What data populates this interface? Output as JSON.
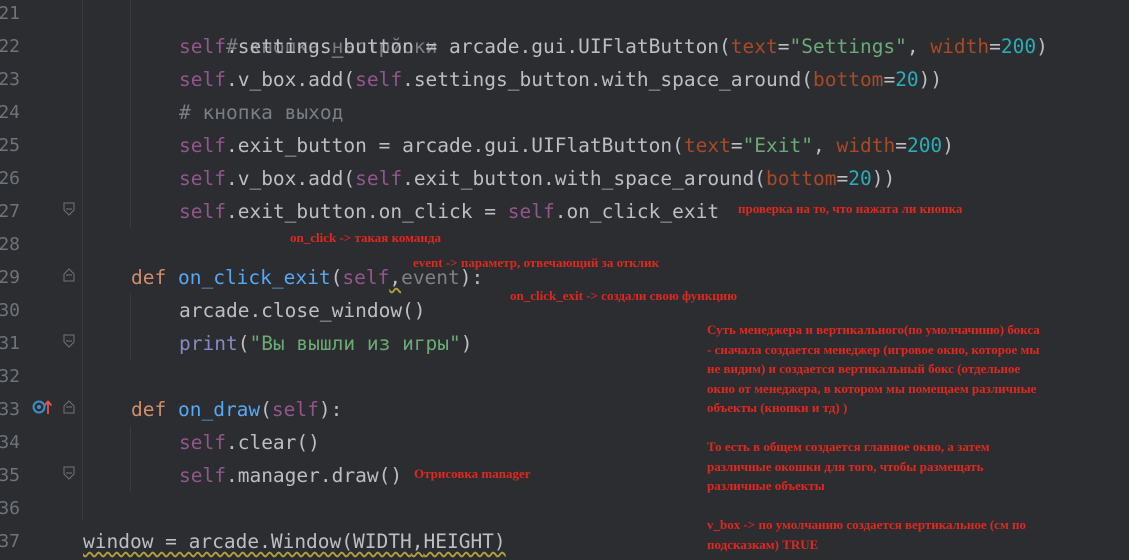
{
  "editor": {
    "line_numbers": [
      "21",
      "22",
      "23",
      "24",
      "25",
      "26",
      "27",
      "28",
      "29",
      "30",
      "31",
      "32",
      "33",
      "34",
      "35",
      "36",
      "37"
    ],
    "lines": {
      "l21": {
        "indent": "        ",
        "comment": "# кнопка настрйоки"
      },
      "l22": {
        "self": "self",
        "p1": ".settings_button = arcade.gui.UIFlatButton(",
        "kw1": "text",
        "eq1": "=",
        "str1": "\"Settings\"",
        "p2": ", ",
        "kw2": "width",
        "eq2": "=",
        "num1": "200",
        "p3": ")"
      },
      "l23": {
        "self": "self",
        "p1": ".v_box.add(",
        "self2": "self",
        "p2": ".settings_button.with_space_around(",
        "kw1": "bottom",
        "eq1": "=",
        "num1": "20",
        "p3": "))"
      },
      "l24": {
        "comment": "# кнопка выход"
      },
      "l25": {
        "self": "self",
        "p1": ".exit_button = arcade.gui.UIFlatButton(",
        "kw1": "text",
        "eq1": "=",
        "str1": "\"Exit\"",
        "p2": ", ",
        "kw2": "width",
        "eq2": "=",
        "num1": "200",
        "p3": ")"
      },
      "l26": {
        "self": "self",
        "p1": ".v_box.add(",
        "self2": "self",
        "p2": ".exit_button.with_space_around(",
        "kw1": "bottom",
        "eq1": "=",
        "num1": "20",
        "p3": "))"
      },
      "l27": {
        "self": "self",
        "p1": ".exit_button.on_click = ",
        "self2": "self",
        "p2": ".on_click_exit"
      },
      "l29": {
        "def": "def",
        "fn": "on_click_exit",
        "p1": "(",
        "self": "self",
        "comma": ",",
        "arg": "event",
        "p2": "):"
      },
      "l30": {
        "text": "arcade.close_window()"
      },
      "l31": {
        "builtin": "print",
        "p1": "(",
        "str": "\"Вы вышли из игры\"",
        "p2": ")"
      },
      "l33": {
        "def": "def",
        "fn": "on_draw",
        "p1": "(",
        "self": "self",
        "p2": "):"
      },
      "l34": {
        "self": "self",
        "p1": ".clear()"
      },
      "l35": {
        "self": "self",
        "p1": ".manager.draw()"
      },
      "l37": {
        "p1": "window = arcade.Window(WIDTH",
        "comma": ",",
        "p2": "HEIGHT)"
      }
    }
  },
  "annotations": {
    "a1": "проверка на то, что нажата ли кнопка",
    "a2": "on_click -> такая команда",
    "a3": "event -> параметр, отвечающий за отклик",
    "a4": "on_click_exit -> создали свою функцию",
    "a5": "Отрисовка manager",
    "a6": "Суть менеджера и вертикального(по умолчачиню) бокса\n- сначала создается менеджер (игровое окно, которое мы\nне видим) и создается вертикальный бокс (отдельное\nокно от менеджера, в котором мы помещаем различные\nобъекты (кнопки и тд) )\n\nТо есть в общем создается главное окно, а затем\nразличные окошки для того, чтобы размещать\nразличные объекты\n\nv_box -> по умолчанию создается вертикальное (см по\nподсказкам) TRUE"
  },
  "icons": {
    "gutter_override": "override-method-icon",
    "fold": "fold-marker-icon"
  },
  "colors": {
    "background": "#2b2d30",
    "keyword": "#cf8e6d",
    "self": "#94558d",
    "string": "#6aab73",
    "number": "#2aacb8",
    "annotation": "#e0281f"
  }
}
